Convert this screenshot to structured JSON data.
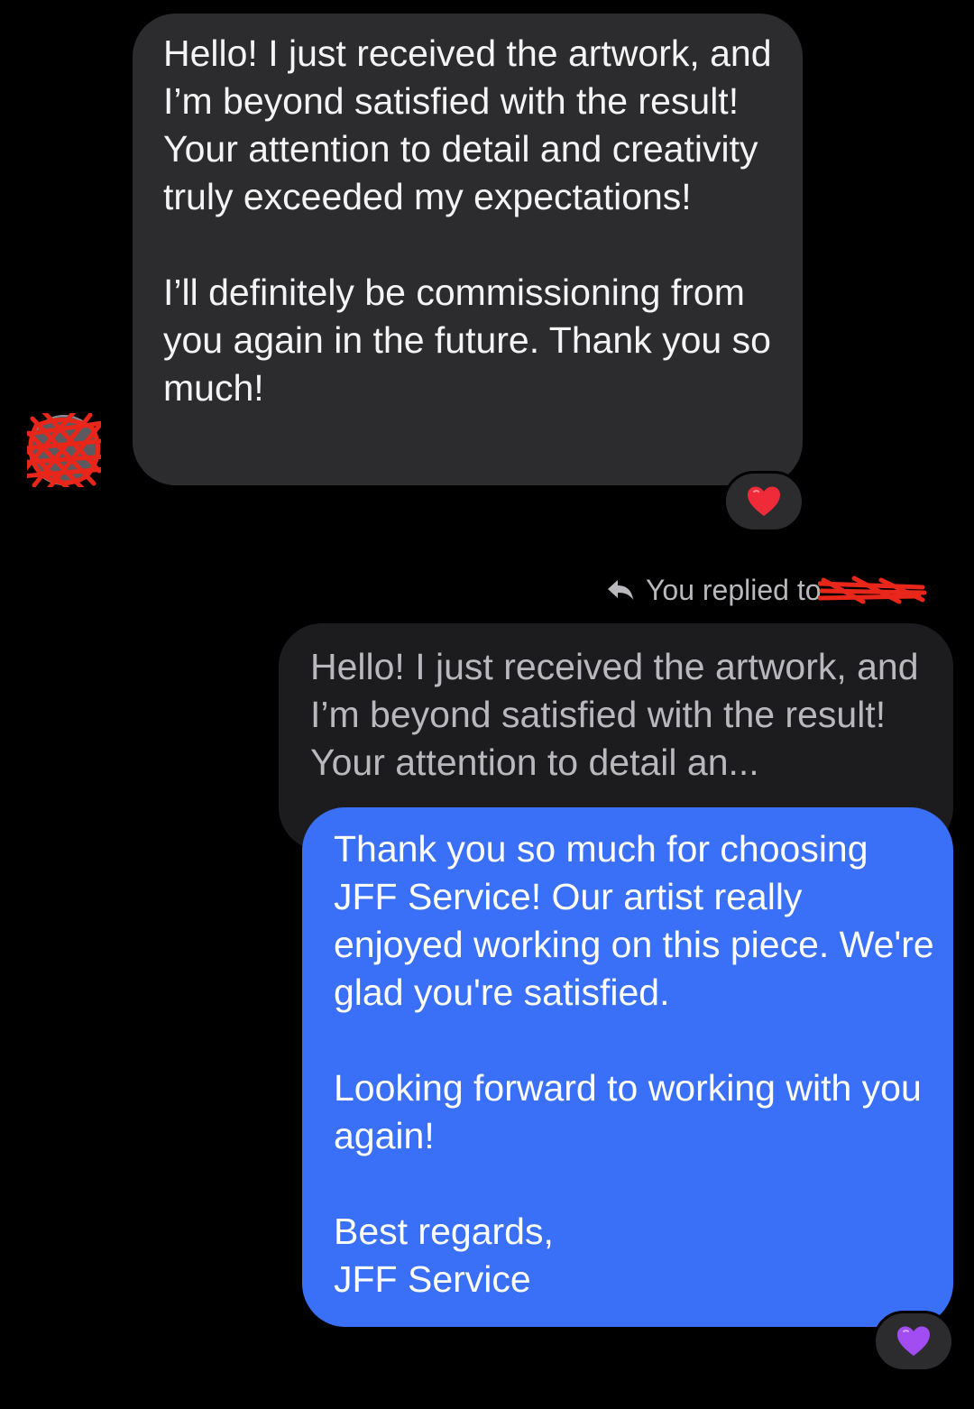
{
  "incoming_message": {
    "text": "Hello! I just received the artwork, and I’m beyond satisfied with the result! Your attention to detail and creativity truly exceeded my expectations!\n\nI’ll definitely be commissioning from you again in the future. Thank you so much!",
    "reaction": "red-heart-icon"
  },
  "reply_header": {
    "label": "You replied to"
  },
  "quoted_message": {
    "text": "Hello! I just received the artwork, and I’m beyond satisfied with the result! Your attention to detail an..."
  },
  "outgoing_message": {
    "text": "Thank you so much for choosing JFF Service! Our artist really enjoyed working on this piece. We're glad you're satisfied.\n\nLooking forward to working with you again!\n\nBest regards,\nJFF Service",
    "reaction": "purple-heart-icon"
  },
  "colors": {
    "background": "#000000",
    "incoming_bubble": "#2c2c2e",
    "quoted_bubble": "#1c1c1e",
    "outgoing_bubble": "#3a6ff7",
    "redaction": "#e8261a",
    "red_heart": "#ef2b3a",
    "purple_heart": "#a24df2"
  }
}
